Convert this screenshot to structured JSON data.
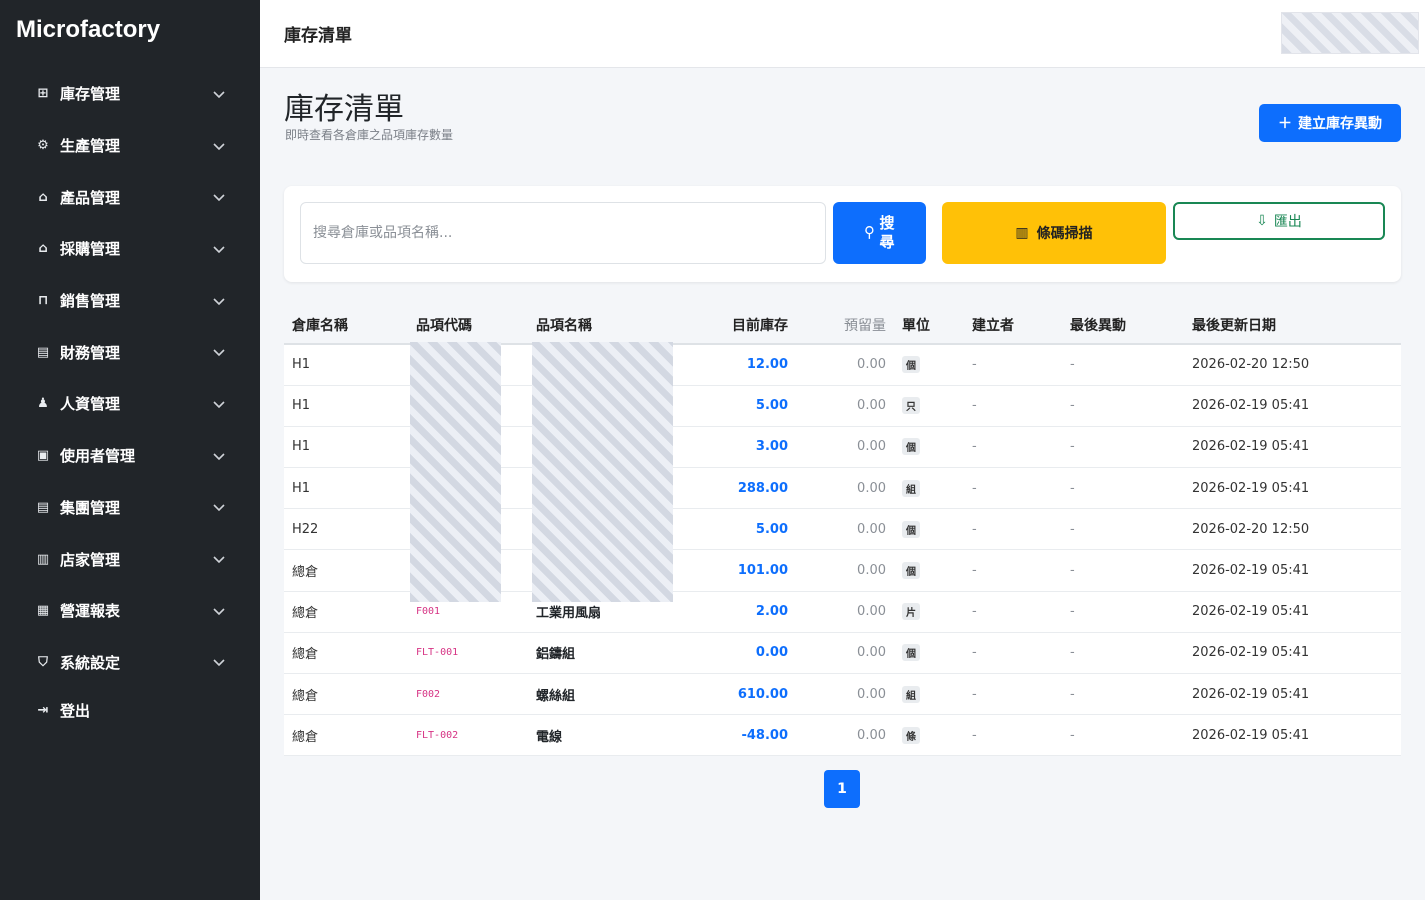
{
  "brand": "Microfactory",
  "sidebar": {
    "items": [
      {
        "icon": "⊞",
        "label": "庫存管理"
      },
      {
        "icon": "⚙",
        "label": "生產管理"
      },
      {
        "icon": "⌂",
        "label": "產品管理"
      },
      {
        "icon": "⌂",
        "label": "採購管理"
      },
      {
        "icon": "⊓",
        "label": "銷售管理"
      },
      {
        "icon": "▤",
        "label": "財務管理"
      },
      {
        "icon": "♟",
        "label": "人資管理"
      },
      {
        "icon": "▣",
        "label": "使用者管理"
      },
      {
        "icon": "▤",
        "label": "集團管理"
      },
      {
        "icon": "▥",
        "label": "店家管理"
      },
      {
        "icon": "▦",
        "label": "營運報表"
      },
      {
        "icon": "⛉",
        "label": "系統設定"
      }
    ],
    "logout": {
      "icon": "⇥",
      "label": "登出"
    }
  },
  "topbar": {
    "breadcrumb": "庫存清單"
  },
  "page": {
    "title": "庫存清單",
    "subtitle": "即時查看各倉庫之品項庫存數量",
    "create_button": "建立庫存異動"
  },
  "search": {
    "placeholder": "搜尋倉庫或品項名稱...",
    "search_button": "搜尋",
    "barcode_button": "條碼掃描",
    "export_button": "匯出"
  },
  "table": {
    "headers": [
      "倉庫名稱",
      "品項代碼",
      "品項名稱",
      "目前庫存",
      "預留量",
      "單位",
      "建立者",
      "最後異動",
      "最後更新日期"
    ],
    "rows": [
      {
        "warehouse": "H1",
        "code": "",
        "name": "",
        "stock": "12.00",
        "reserved": "0.00",
        "unit": "個",
        "creator": "-",
        "last_change": "-",
        "updated": "2026-02-20 12:50"
      },
      {
        "warehouse": "H1",
        "code": "",
        "name": "",
        "stock": "5.00",
        "reserved": "0.00",
        "unit": "只",
        "creator": "-",
        "last_change": "-",
        "updated": "2026-02-19 05:41"
      },
      {
        "warehouse": "H1",
        "code": "",
        "name": "",
        "stock": "3.00",
        "reserved": "0.00",
        "unit": "個",
        "creator": "-",
        "last_change": "-",
        "updated": "2026-02-19 05:41"
      },
      {
        "warehouse": "H1",
        "code": "",
        "name": "",
        "stock": "288.00",
        "reserved": "0.00",
        "unit": "組",
        "creator": "-",
        "last_change": "-",
        "updated": "2026-02-19 05:41"
      },
      {
        "warehouse": "H22",
        "code": "",
        "name": "",
        "stock": "5.00",
        "reserved": "0.00",
        "unit": "個",
        "creator": "-",
        "last_change": "-",
        "updated": "2026-02-20 12:50"
      },
      {
        "warehouse": "總倉",
        "code": "",
        "name": "",
        "stock": "101.00",
        "reserved": "0.00",
        "unit": "個",
        "creator": "-",
        "last_change": "-",
        "updated": "2026-02-19 05:41"
      },
      {
        "warehouse": "總倉",
        "code": "F001",
        "name": "工業用風扇",
        "stock": "2.00",
        "reserved": "0.00",
        "unit": "片",
        "creator": "-",
        "last_change": "-",
        "updated": "2026-02-19 05:41"
      },
      {
        "warehouse": "總倉",
        "code": "FLT-001",
        "name": "鋁鑄組",
        "stock": "0.00",
        "reserved": "0.00",
        "unit": "個",
        "creator": "-",
        "last_change": "-",
        "updated": "2026-02-19 05:41"
      },
      {
        "warehouse": "總倉",
        "code": "F002",
        "name": "螺絲組",
        "stock": "610.00",
        "reserved": "0.00",
        "unit": "組",
        "creator": "-",
        "last_change": "-",
        "updated": "2026-02-19 05:41"
      },
      {
        "warehouse": "總倉",
        "code": "FLT-002",
        "name": "電線",
        "stock": "-48.00",
        "reserved": "0.00",
        "unit": "條",
        "creator": "-",
        "last_change": "-",
        "updated": "2026-02-19 05:41"
      }
    ]
  },
  "pagination": {
    "current": "1"
  },
  "colors": {
    "sidebar_bg": "#212529",
    "primary": "#0d6efd",
    "warning": "#ffc107",
    "success": "#198754",
    "code_pink": "#d63384"
  }
}
